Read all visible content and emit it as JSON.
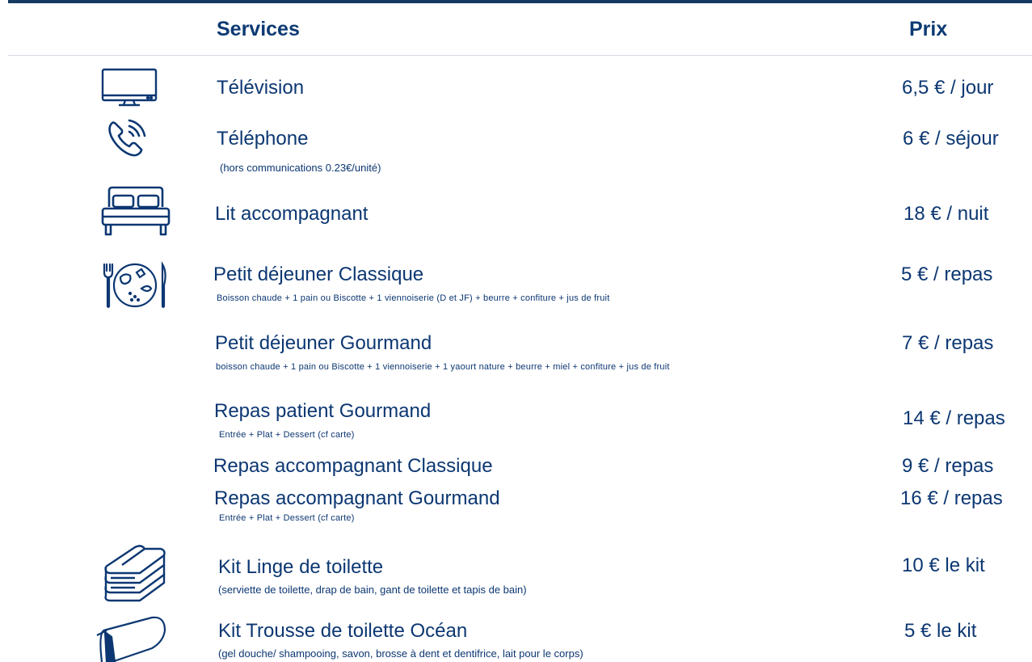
{
  "header": {
    "services": "Services",
    "price": "Prix"
  },
  "rows": [
    {
      "icon": "television-icon",
      "title": "Télévision",
      "price": "6,5 € / jour"
    },
    {
      "icon": "phone-icon",
      "title": "Téléphone",
      "note": "(hors communications 0.23€/unité)",
      "price": "6 € / séjour"
    },
    {
      "icon": "bed-icon",
      "title": "Lit accompagnant",
      "price": "18 € / nuit"
    },
    {
      "icon": "meal-plate-icon",
      "title": "Petit déjeuner Classique",
      "note": "Boisson chaude + 1 pain ou Biscotte + 1 viennoiserie (D et JF) + beurre + confiture + jus de fruit",
      "price": "5 € / repas"
    },
    {
      "title": "Petit déjeuner Gourmand",
      "note": "boisson chaude + 1 pain ou Biscotte + 1 viennoiserie + 1 yaourt nature + beurre + miel + confiture + jus de fruit",
      "price": "7 € / repas"
    },
    {
      "title": "Repas patient Gourmand",
      "note": "Entrée + Plat + Dessert (cf carte)",
      "price": "14 € / repas"
    },
    {
      "title": "Repas accompagnant Classique",
      "price": "9 € / repas"
    },
    {
      "title": "Repas accompagnant Gourmand",
      "note": "Entrée + Plat + Dessert (cf carte)",
      "price": "16 € / repas"
    },
    {
      "icon": "folded-towels-icon",
      "title": "Kit Linge de toilette",
      "note": "(serviette de toilette, drap de bain, gant de toilette et tapis de bain)",
      "price": "10 € le kit"
    },
    {
      "icon": "toiletry-pouch-icon",
      "title": "Kit Trousse de toilette Océan",
      "note": "(gel douche/ shampooing, savon, brosse à dent et dentifrice, lait pour le corps)",
      "price": "5 € le kit"
    }
  ]
}
